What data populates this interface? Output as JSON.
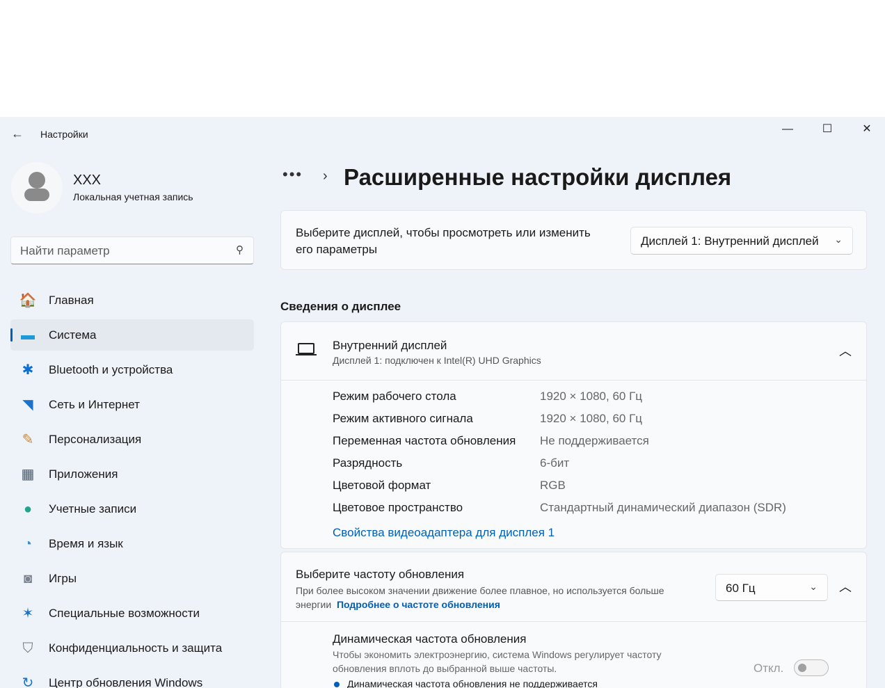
{
  "window": {
    "title": "Настройки",
    "minimize": "—",
    "maximize": "☐",
    "close": "✕"
  },
  "user": {
    "name": "XXX",
    "account_type": "Локальная учетная запись"
  },
  "search": {
    "placeholder": "Найти параметр"
  },
  "sidebar": {
    "items": [
      {
        "label": "Главная",
        "icon": "home-icon",
        "glyph": "🏠",
        "color": "#e8783a"
      },
      {
        "label": "Система",
        "icon": "system-icon",
        "glyph": "▬",
        "color": "#1e9bd7",
        "selected": true
      },
      {
        "label": "Bluetooth и устройства",
        "icon": "bluetooth-icon",
        "glyph": "✱",
        "color": "#0a6fd1"
      },
      {
        "label": "Сеть и Интернет",
        "icon": "wifi-icon",
        "glyph": "◥",
        "color": "#1a73c9"
      },
      {
        "label": "Персонализация",
        "icon": "brush-icon",
        "glyph": "✎",
        "color": "#c9893a"
      },
      {
        "label": "Приложения",
        "icon": "apps-icon",
        "glyph": "▦",
        "color": "#4a5a6a"
      },
      {
        "label": "Учетные записи",
        "icon": "accounts-icon",
        "glyph": "●",
        "color": "#23a48a"
      },
      {
        "label": "Время и язык",
        "icon": "time-language-icon",
        "glyph": "◔",
        "color": "#2b8fd6"
      },
      {
        "label": "Игры",
        "icon": "gaming-icon",
        "glyph": "◙",
        "color": "#7a8290"
      },
      {
        "label": "Специальные возможности",
        "icon": "accessibility-icon",
        "glyph": "✶",
        "color": "#1a73c9"
      },
      {
        "label": "Конфиденциальность и защита",
        "icon": "shield-icon",
        "glyph": "⛉",
        "color": "#6e7480"
      },
      {
        "label": "Центр обновления Windows",
        "icon": "update-icon",
        "glyph": "↻",
        "color": "#1a73c9"
      }
    ]
  },
  "header": {
    "breadcrumb_more": "•••",
    "title": "Расширенные настройки дисплея"
  },
  "select_display": {
    "text": "Выберите дисплей, чтобы просмотреть или изменить его параметры",
    "value": "Дисплей 1: Внутренний дисплей"
  },
  "display_info": {
    "section_title": "Сведения о дисплее",
    "name": "Внутренний дисплей",
    "subtitle": "Дисплей 1: подключен к Intel(R) UHD Graphics",
    "rows": [
      {
        "label": "Режим рабочего стола",
        "value": "1920 × 1080, 60 Гц"
      },
      {
        "label": "Режим активного сигнала",
        "value": "1920 × 1080, 60 Гц"
      },
      {
        "label": "Переменная частота обновления",
        "value": "Не поддерживается"
      },
      {
        "label": "Разрядность",
        "value": "6-бит"
      },
      {
        "label": "Цветовой формат",
        "value": "RGB"
      },
      {
        "label": "Цветовое пространство",
        "value": "Стандартный динамический диапазон (SDR)"
      }
    ],
    "adapter_link": "Свойства видеоадаптера для дисплея 1"
  },
  "refresh": {
    "title": "Выберите частоту обновления",
    "desc": "При более высоком значении движение более плавное, но используется больше энергии",
    "link": "Подробнее о частоте обновления",
    "value": "60 Гц",
    "dynamic_title": "Динамическая частота обновления",
    "dynamic_desc": "Чтобы экономить электроэнергию, система Windows регулирует частоту обновления вплоть до выбранной выше частоты.",
    "toggle_state": "Откл.",
    "toggle_on": false,
    "note": "Динамическая частота обновления не поддерживается"
  }
}
